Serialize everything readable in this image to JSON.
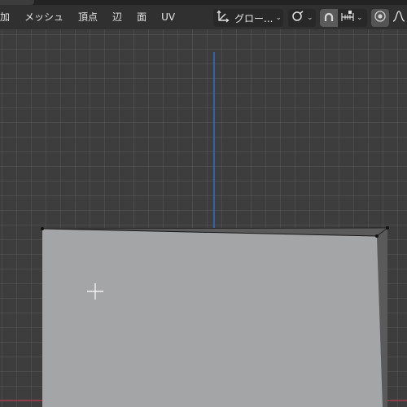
{
  "header": {
    "menu": [
      {
        "label": "加"
      },
      {
        "label": "メッシュ"
      },
      {
        "label": "頂点"
      },
      {
        "label": "辺"
      },
      {
        "label": "面"
      },
      {
        "label": "UV"
      }
    ],
    "pivot_label": "グロー...",
    "icons": {
      "pivot": "transform-pivot-icon",
      "link": "link-icon",
      "snap": "magnet-snap-icon",
      "snap_target": "snap-increment-icon",
      "proportional": "proportional-editing-icon",
      "falloff": "falloff-curve-icon"
    }
  },
  "viewport": {
    "colors": {
      "background": "#3d3d3d",
      "grid": "#474747",
      "axis_z": "#2a6ecf",
      "axis_x": "#a33a4a",
      "face": "#a4a5a7",
      "face_side": "#5a5a5a",
      "vertex": "#111111"
    }
  }
}
